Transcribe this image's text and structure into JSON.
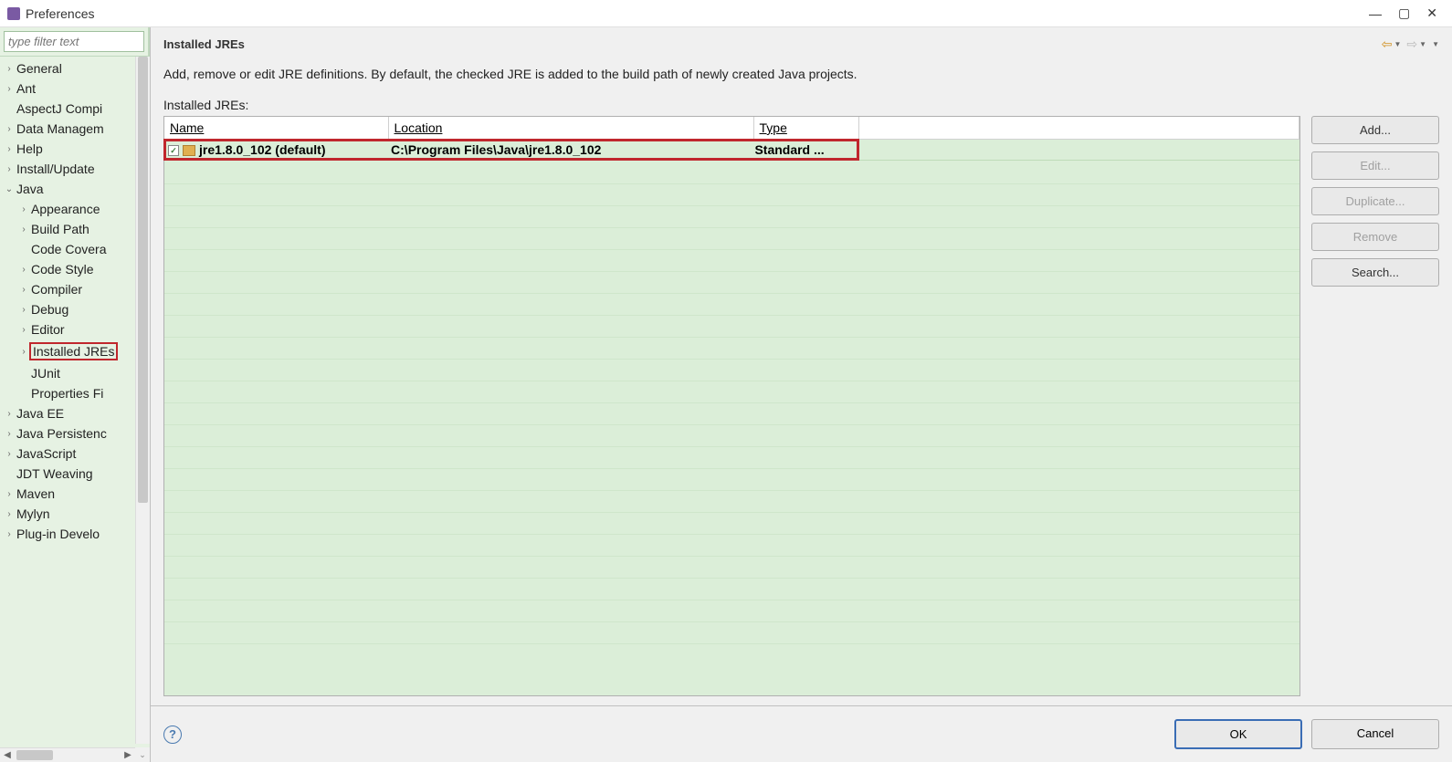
{
  "titlebar": {
    "title": "Preferences"
  },
  "sidebar": {
    "filter_placeholder": "type filter text",
    "items": [
      {
        "label": "General",
        "level": 1,
        "expandable": true
      },
      {
        "label": "Ant",
        "level": 1,
        "expandable": true
      },
      {
        "label": "AspectJ Compi",
        "level": 1,
        "expandable": false
      },
      {
        "label": "Data Managem",
        "level": 1,
        "expandable": true
      },
      {
        "label": "Help",
        "level": 1,
        "expandable": true
      },
      {
        "label": "Install/Update",
        "level": 1,
        "expandable": true
      },
      {
        "label": "Java",
        "level": 1,
        "expandable": true,
        "expanded": true
      },
      {
        "label": "Appearance",
        "level": 2,
        "expandable": true
      },
      {
        "label": "Build Path",
        "level": 2,
        "expandable": true
      },
      {
        "label": "Code Covera",
        "level": 2,
        "expandable": false
      },
      {
        "label": "Code Style",
        "level": 2,
        "expandable": true
      },
      {
        "label": "Compiler",
        "level": 2,
        "expandable": true
      },
      {
        "label": "Debug",
        "level": 2,
        "expandable": true
      },
      {
        "label": "Editor",
        "level": 2,
        "expandable": true
      },
      {
        "label": "Installed JREs",
        "level": 2,
        "expandable": true,
        "highlighted": true
      },
      {
        "label": "JUnit",
        "level": 2,
        "expandable": false
      },
      {
        "label": "Properties Fi",
        "level": 2,
        "expandable": false
      },
      {
        "label": "Java EE",
        "level": 1,
        "expandable": true
      },
      {
        "label": "Java Persistenc",
        "level": 1,
        "expandable": true
      },
      {
        "label": "JavaScript",
        "level": 1,
        "expandable": true
      },
      {
        "label": "JDT Weaving",
        "level": 1,
        "expandable": false
      },
      {
        "label": "Maven",
        "level": 1,
        "expandable": true
      },
      {
        "label": "Mylyn",
        "level": 1,
        "expandable": true
      },
      {
        "label": "Plug-in Develo",
        "level": 1,
        "expandable": true
      }
    ]
  },
  "content": {
    "page_title": "Installed JREs",
    "description": "Add, remove or edit JRE definitions. By default, the checked JRE is added to the build path of newly created Java projects.",
    "table_label": "Installed JREs:",
    "columns": {
      "name": "Name",
      "location": "Location",
      "type": "Type"
    },
    "rows": [
      {
        "checked": true,
        "name": "jre1.8.0_102 (default)",
        "location": "C:\\Program Files\\Java\\jre1.8.0_102",
        "type": "Standard ..."
      }
    ],
    "buttons": {
      "add": "Add...",
      "edit": "Edit...",
      "duplicate": "Duplicate...",
      "remove": "Remove",
      "search": "Search..."
    }
  },
  "footer": {
    "ok": "OK",
    "cancel": "Cancel"
  }
}
